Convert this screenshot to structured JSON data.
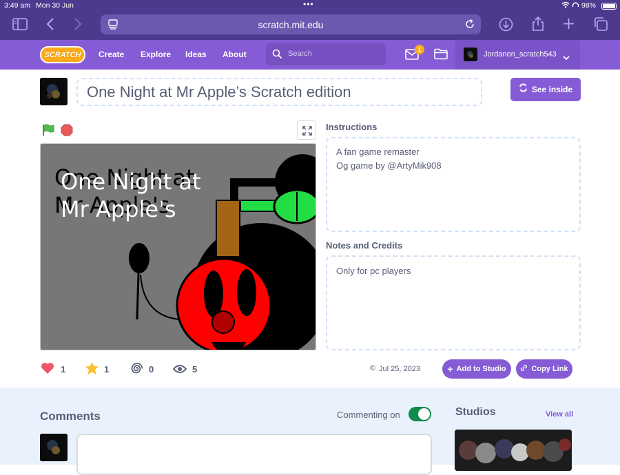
{
  "status_bar": {
    "time": "3:49 am",
    "date": "Mon 30 Jun",
    "battery": "98%"
  },
  "browser": {
    "url": "scratch.mit.edu"
  },
  "nav": {
    "logo": "SCRATCH",
    "links": [
      "Create",
      "Explore",
      "Ideas",
      "About"
    ],
    "search_placeholder": "Search",
    "messages_count": "1",
    "username": "Jordanon_scratch543"
  },
  "project": {
    "title": "One Night at Mr Apple’s Scratch edition",
    "see_inside_label": "See inside",
    "stage_title_line1": "One Night at",
    "stage_title_line2": "Mr Apple's",
    "instructions_heading": "Instructions",
    "instructions_lines": [
      "A fan game remaster",
      "Og game by @ArtyMik908"
    ],
    "notes_heading": "Notes and Credits",
    "notes_text": "Only for pc players",
    "stats": {
      "loves": "1",
      "favorites": "1",
      "remixes": "0",
      "views": "5"
    },
    "date": "Jul 25, 2023",
    "add_to_studio_label": "Add to Studio",
    "copy_link_label": "Copy Link"
  },
  "comments": {
    "heading": "Comments",
    "commenting_label": "Commenting on",
    "commenting_on": true
  },
  "studios": {
    "heading": "Studios",
    "view_all_label": "View all"
  },
  "colors": {
    "scratch_purple": "#855cd6",
    "safari_bar": "#4d3a8f",
    "toggle_green": "#0f8b4a",
    "lower_bg": "#e9f1fc"
  }
}
